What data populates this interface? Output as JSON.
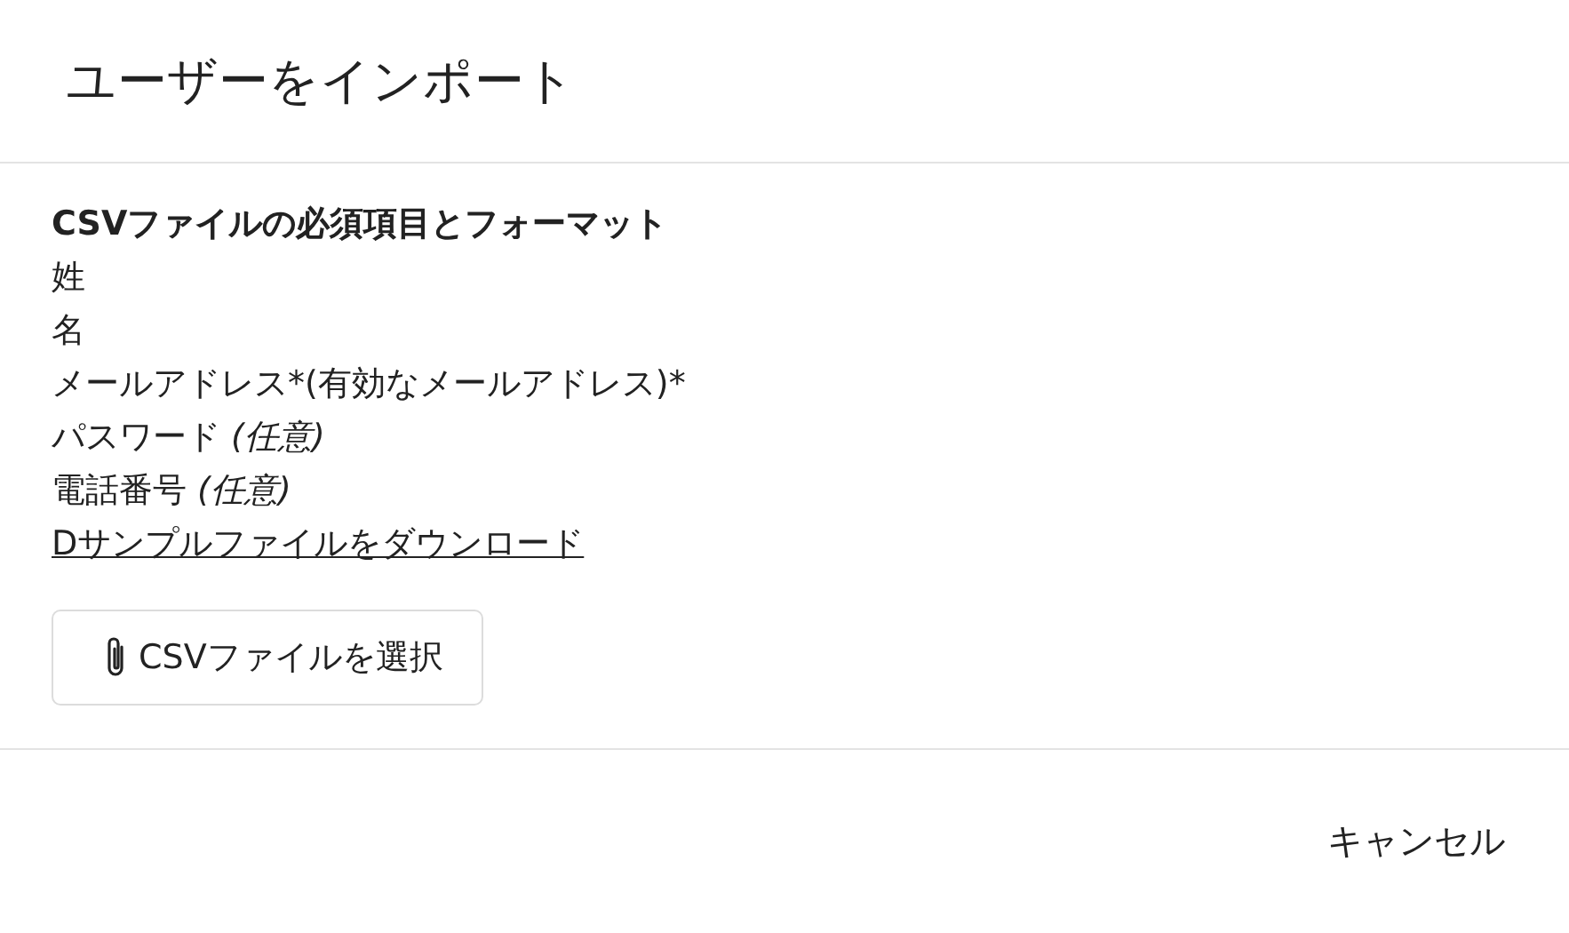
{
  "dialog": {
    "title": "ユーザーをインポート"
  },
  "requirements": {
    "heading": "CSVファイルの必須項目とフォーマット",
    "fields": [
      "姓",
      "名",
      "メールアドレス*(有効なメールアドレス)*",
      "パスワード *(任意)*",
      "電話番号 *(任意)*"
    ],
    "download_link": "Dサンプルファイルをダウンロード"
  },
  "file_button": {
    "label": "CSVファイルを選択"
  },
  "footer_buttons": [
    "キャンセル"
  ]
}
